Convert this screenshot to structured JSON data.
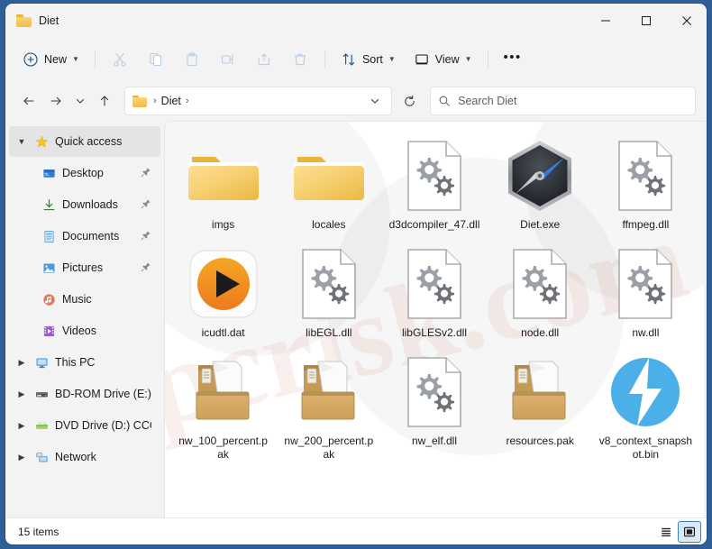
{
  "window": {
    "title": "Diet",
    "title_icon": "folder-icon",
    "controls": {
      "minimize": "minimize-icon",
      "maximize": "maximize-icon",
      "close": "close-icon"
    }
  },
  "toolbar": {
    "new_label": "New",
    "new_icon": "plus-circle-icon",
    "cut_icon": "scissors-icon",
    "copy_icon": "copy-icon",
    "paste_icon": "clipboard-icon",
    "rename_icon": "rename-icon",
    "share_icon": "share-icon",
    "delete_icon": "trash-icon",
    "sort_label": "Sort",
    "sort_icon": "sort-arrows-icon",
    "view_label": "View",
    "view_icon": "monitor-icon",
    "more_label": "•••"
  },
  "address": {
    "back_icon": "arrow-left-icon",
    "forward_icon": "arrow-right-icon",
    "recent_icon": "chevron-down-icon",
    "up_icon": "arrow-up-icon",
    "breadcrumb_icon": "folder-icon",
    "breadcrumb": [
      "Diet"
    ],
    "dropdown_icon": "chevron-down-icon",
    "refresh_icon": "refresh-icon",
    "search_icon": "search-icon",
    "search_placeholder": "Search Diet",
    "search_value": ""
  },
  "sidebar": {
    "items": [
      {
        "label": "Quick access",
        "icon": "star-icon",
        "arrow": "chevron-down",
        "indent": 0,
        "selected": true,
        "pinned": false
      },
      {
        "label": "Desktop",
        "icon": "desktop-icon",
        "arrow": "none",
        "indent": 1,
        "selected": false,
        "pinned": true
      },
      {
        "label": "Downloads",
        "icon": "download-icon",
        "arrow": "none",
        "indent": 1,
        "selected": false,
        "pinned": true
      },
      {
        "label": "Documents",
        "icon": "document-icon",
        "arrow": "none",
        "indent": 1,
        "selected": false,
        "pinned": true
      },
      {
        "label": "Pictures",
        "icon": "pictures-icon",
        "arrow": "none",
        "indent": 1,
        "selected": false,
        "pinned": true
      },
      {
        "label": "Music",
        "icon": "music-icon",
        "arrow": "none",
        "indent": 1,
        "selected": false,
        "pinned": false
      },
      {
        "label": "Videos",
        "icon": "video-icon",
        "arrow": "none",
        "indent": 1,
        "selected": false,
        "pinned": false
      },
      {
        "label": "This PC",
        "icon": "pc-icon",
        "arrow": "chevron-right",
        "indent": 0,
        "selected": false,
        "pinned": false
      },
      {
        "label": "BD-ROM Drive (E:) C",
        "icon": "bdrom-icon",
        "arrow": "chevron-right",
        "indent": 0,
        "selected": false,
        "pinned": false
      },
      {
        "label": "DVD Drive (D:) CCCC",
        "icon": "dvd-icon",
        "arrow": "chevron-right",
        "indent": 0,
        "selected": false,
        "pinned": false
      },
      {
        "label": "Network",
        "icon": "network-icon",
        "arrow": "chevron-right",
        "indent": 0,
        "selected": false,
        "pinned": false
      }
    ]
  },
  "files": [
    {
      "name": "imgs",
      "icon": "folder-icon"
    },
    {
      "name": "locales",
      "icon": "folder-icon"
    },
    {
      "name": "d3dcompiler_47.dll",
      "icon": "dll-gears-icon"
    },
    {
      "name": "Diet.exe",
      "icon": "diet-compass-icon"
    },
    {
      "name": "ffmpeg.dll",
      "icon": "dll-gears-icon"
    },
    {
      "name": "icudtl.dat",
      "icon": "media-play-icon"
    },
    {
      "name": "libEGL.dll",
      "icon": "dll-gears-icon"
    },
    {
      "name": "libGLESv2.dll",
      "icon": "dll-gears-icon"
    },
    {
      "name": "node.dll",
      "icon": "dll-gears-icon"
    },
    {
      "name": "nw.dll",
      "icon": "dll-gears-icon"
    },
    {
      "name": "nw_100_percent.pak",
      "icon": "package-box-icon"
    },
    {
      "name": "nw_200_percent.pak",
      "icon": "package-box-icon"
    },
    {
      "name": "nw_elf.dll",
      "icon": "dll-gears-icon"
    },
    {
      "name": "resources.pak",
      "icon": "package-box-icon"
    },
    {
      "name": "v8_context_snapshot.bin",
      "icon": "bolt-circle-icon"
    }
  ],
  "status": {
    "item_count": "15 items",
    "list_view_icon": "list-view-icon",
    "grid_view_icon": "large-icons-view-icon",
    "active_view": "large-icons-view-icon"
  },
  "watermark": {
    "text": "pcrisk.com"
  },
  "colors": {
    "accent": "#3a7fc1",
    "window_frame": "#2f5f96",
    "folder": "#f0bc48",
    "bolt_blue": "#4caee8",
    "media_orange": "#ef8a21",
    "package_tan": "#d8a košík"
  }
}
